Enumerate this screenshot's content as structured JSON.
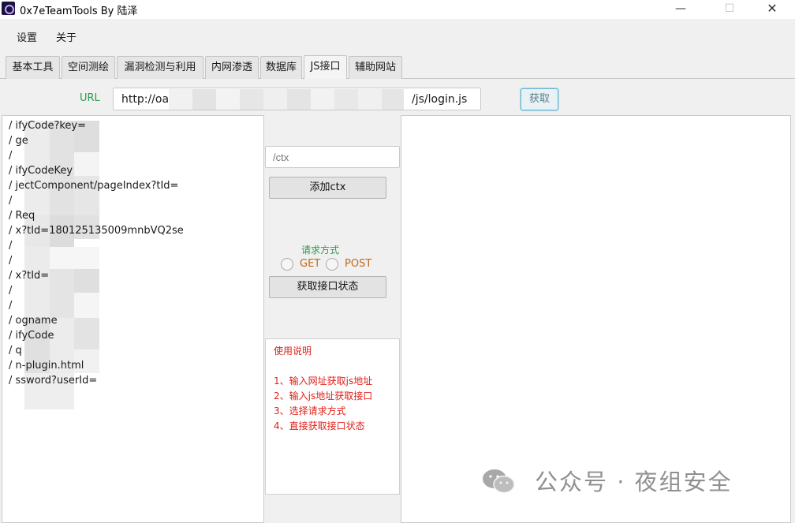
{
  "window": {
    "title": "0x7eTeamTools By 陆泽",
    "minimize": "—",
    "maximize": "☐",
    "close": "✕"
  },
  "menu": [
    "设置",
    "关于"
  ],
  "tabs": [
    {
      "label": "基本工具",
      "active": false
    },
    {
      "label": "空间测绘",
      "active": false
    },
    {
      "label": "漏洞检测与利用",
      "active": false
    },
    {
      "label": "内网渗透",
      "active": false
    },
    {
      "label": "数据库",
      "active": false
    },
    {
      "label": "JS接口",
      "active": true
    },
    {
      "label": "辅助网站",
      "active": false
    }
  ],
  "url": {
    "label": "URL",
    "value_start": "http://oa",
    "value_end": "/js/login.js"
  },
  "fetch_button": "获取",
  "endpoints": [
    "/                    ifyCode?key=",
    "/                    ge",
    "/",
    "/                    ifyCodeKey",
    "/                    jectComponent/pageIndex?tId=",
    "/",
    "/                    Req",
    "/                    x?tId=180125135009mnbVQ2se",
    "/",
    "/",
    "/                    x?tId=",
    "/",
    "/",
    "/                    ogname",
    "/                    ifyCode",
    "/                    q",
    "/                    n-plugin.html",
    "/                    ssword?userId="
  ],
  "ctx_input": {
    "placeholder": "/ctx"
  },
  "add_ctx_button": "添加ctx",
  "request_method": {
    "label": "请求方式",
    "options": [
      "GET",
      "POST"
    ],
    "selected": ""
  },
  "status_button": "获取接口状态",
  "help": {
    "title": "使用说明",
    "steps": [
      "1、输入网址获取js地址",
      "2、输入js地址获取接口",
      "3、选择请求方式",
      "4、直接获取接口状态"
    ]
  },
  "watermark": "公众号 · 夜组安全",
  "colors": {
    "accent_green": "#2b9b4a",
    "radio_label_orange": "#c06a1c",
    "help_red": "#e0201a",
    "fetch_border": "#6eb5cf"
  }
}
